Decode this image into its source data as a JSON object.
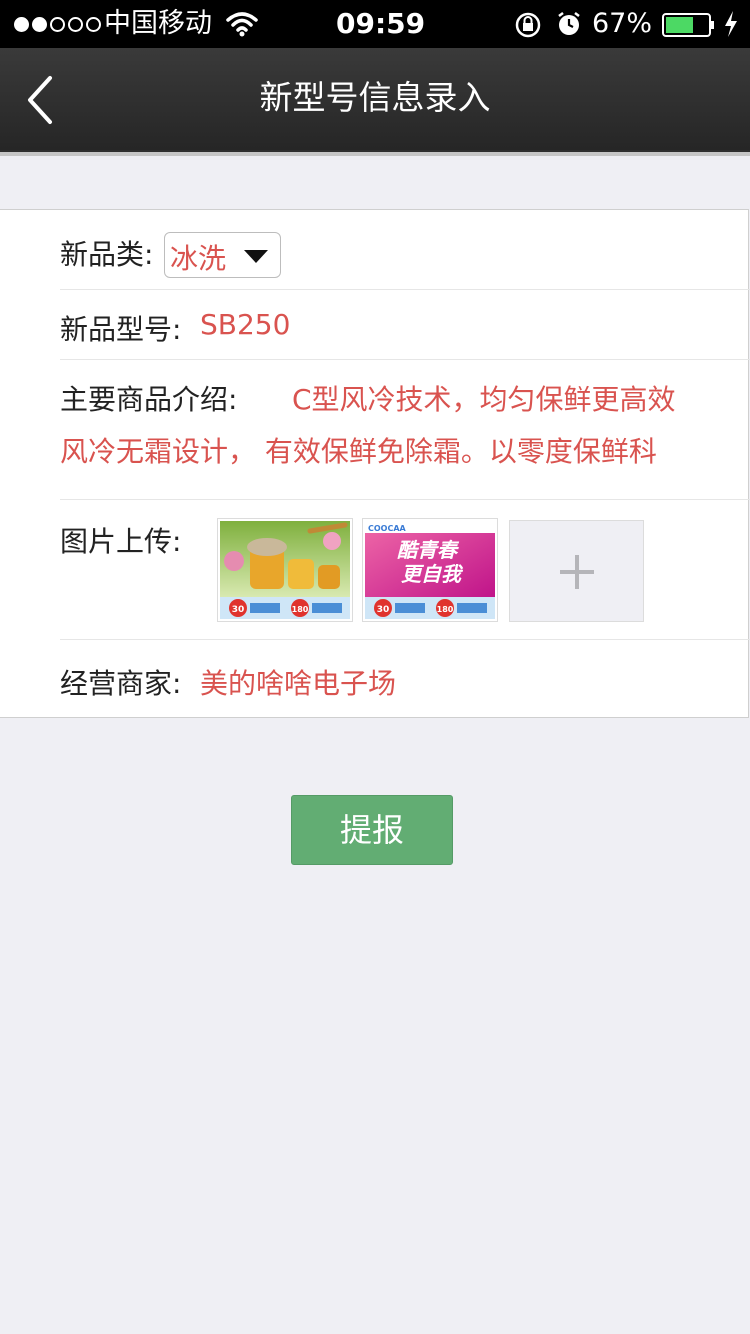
{
  "status_bar": {
    "carrier": "中国移动",
    "time": "09:59",
    "battery_percent": "67%",
    "battery_level": 0.67,
    "signal_bars_filled": 2,
    "signal_bars_total": 5,
    "icons": [
      "wifi-icon",
      "rotation-lock-icon",
      "alarm-icon",
      "battery-icon",
      "charging-icon"
    ]
  },
  "nav": {
    "title": "新型号信息录入",
    "back_icon": "chevron-left-icon"
  },
  "form": {
    "category": {
      "label": "新品类:",
      "value": "冰洗"
    },
    "model": {
      "label": "新品型号:",
      "value": "SB250"
    },
    "intro": {
      "label": "主要商品介绍:",
      "line1": "C型风冷技术，均匀保鲜更高效",
      "line2": "风冷无霜设计， 有效保鲜免除霜。以零度保鲜科"
    },
    "images": {
      "label": "图片上传:",
      "thumb1": {
        "badge_left": "30",
        "badge_right": "180",
        "icon": "product-photo-honey"
      },
      "thumb2": {
        "brand": "COOCAA",
        "headline_1": "酷青春",
        "headline_2": "更自我",
        "badge_left": "30",
        "badge_right": "180",
        "icon": "product-photo-tv"
      },
      "add_icon": "plus-icon"
    },
    "merchant": {
      "label": "经营商家:",
      "value": "美的啥啥电子场"
    }
  },
  "submit_label": "提报",
  "colors": {
    "accent_value": "#d9534f",
    "submit_button": "#62ad73",
    "nav_bar": "#2f2f2f",
    "background": "#efeff4"
  }
}
